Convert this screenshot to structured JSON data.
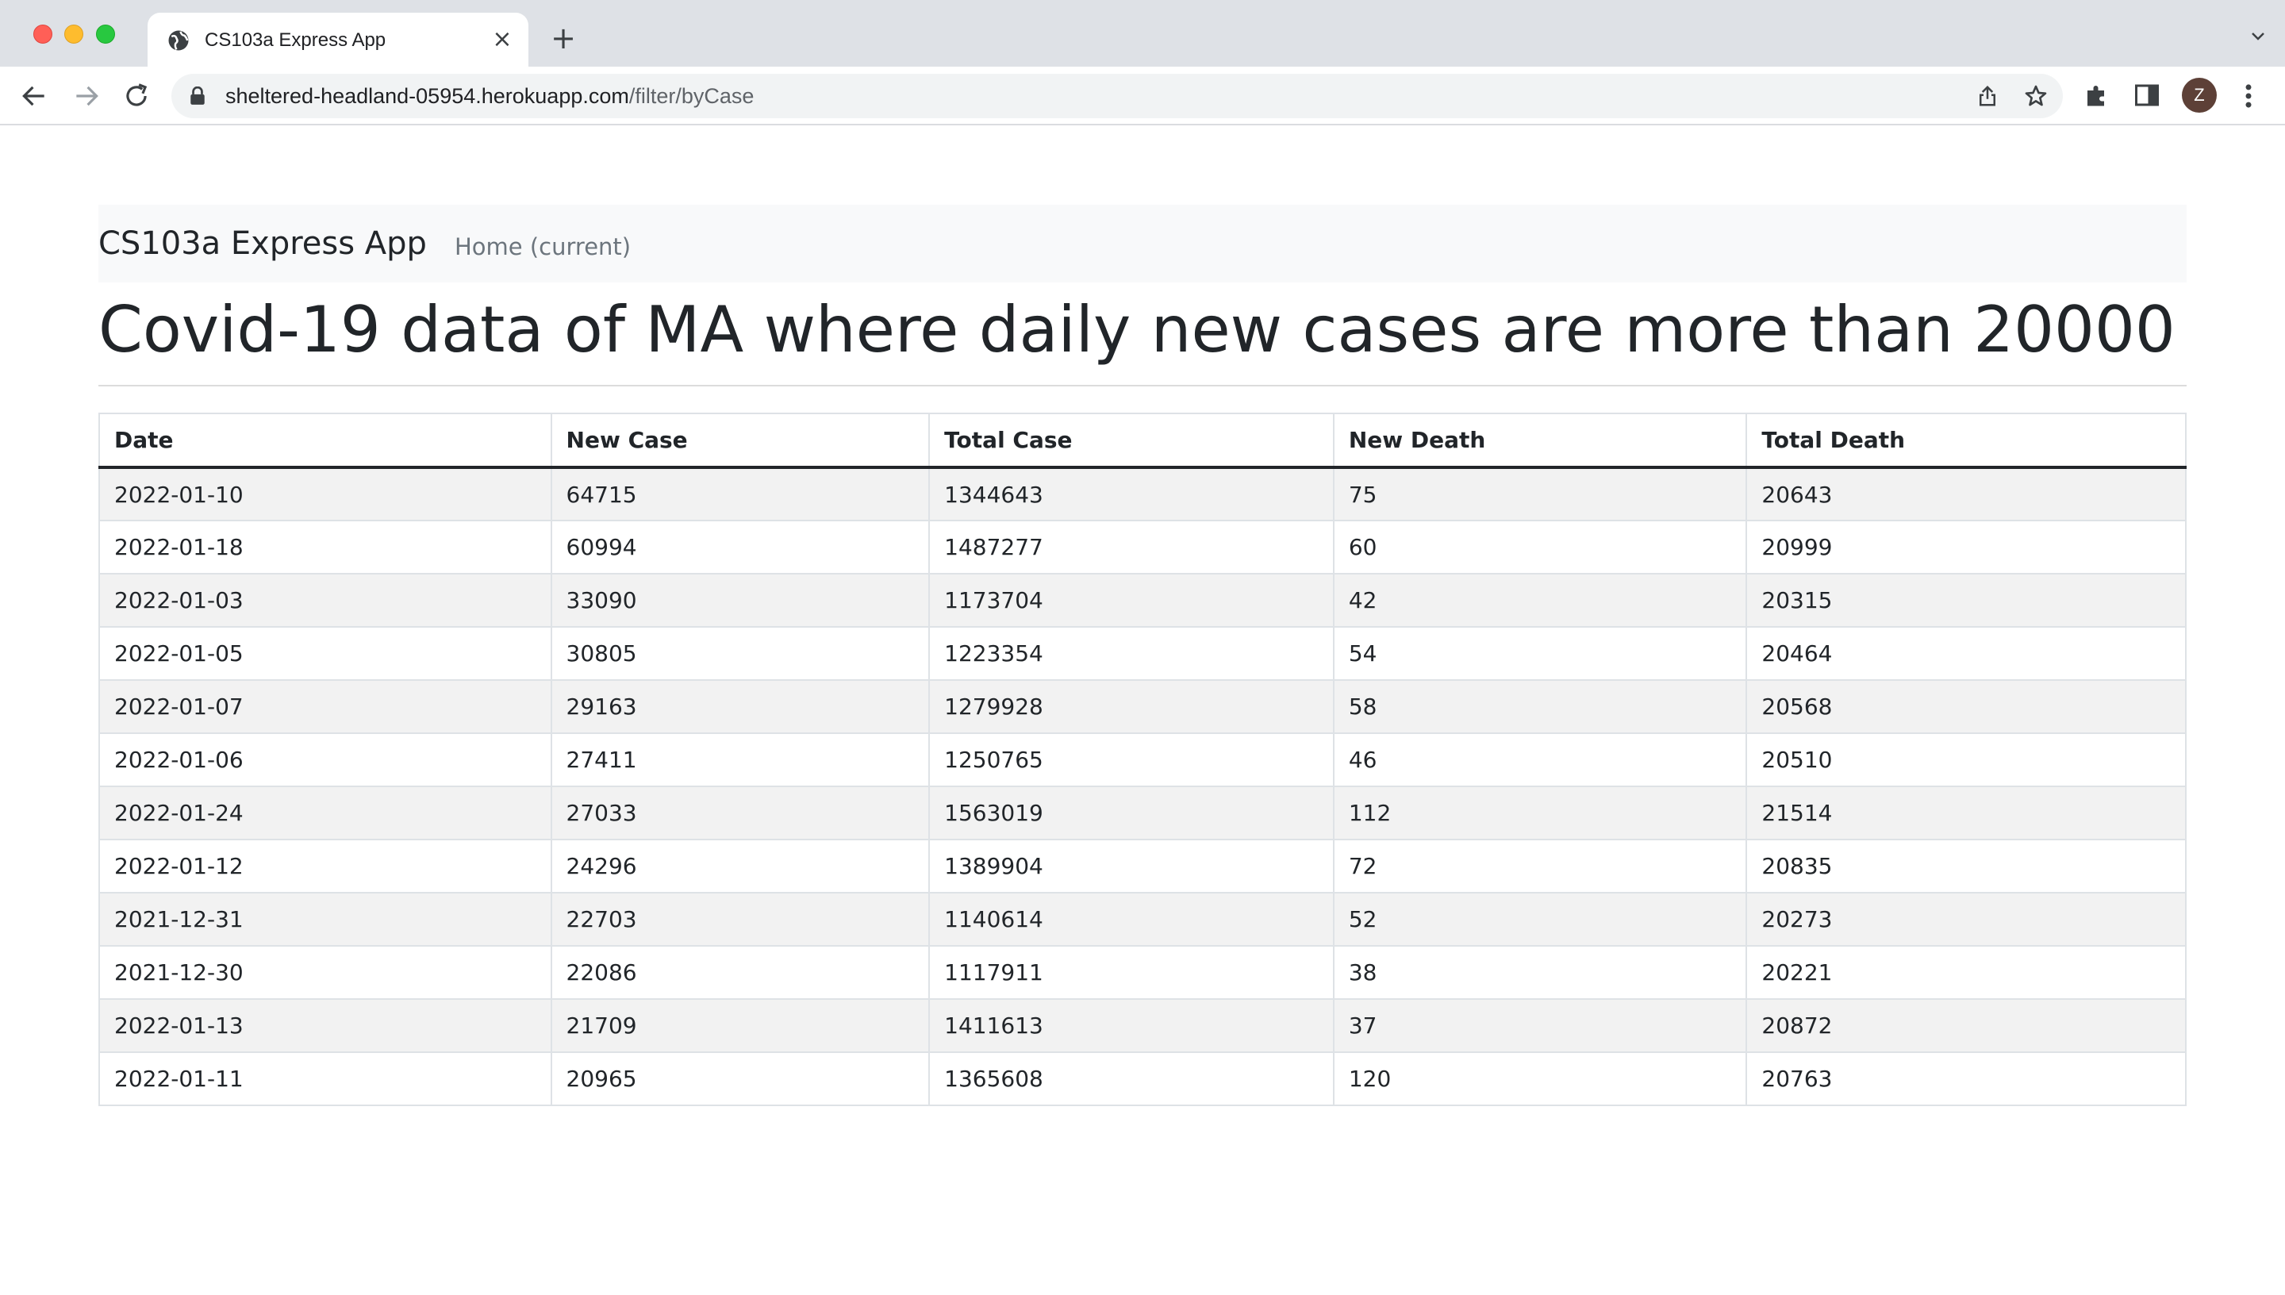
{
  "browser": {
    "tab_title": "CS103a Express App",
    "url_host": "sheltered-headland-05954.herokuapp.com",
    "url_path": "/filter/byCase",
    "profile_initial": "Z"
  },
  "navbar": {
    "brand": "CS103a Express App",
    "home_link": "Home (current)"
  },
  "heading": "Covid-19 data of MA where daily new cases are more than 20000",
  "table": {
    "headers": [
      "Date",
      "New Case",
      "Total Case",
      "New Death",
      "Total Death"
    ],
    "rows": [
      [
        "2022-01-10",
        "64715",
        "1344643",
        "75",
        "20643"
      ],
      [
        "2022-01-18",
        "60994",
        "1487277",
        "60",
        "20999"
      ],
      [
        "2022-01-03",
        "33090",
        "1173704",
        "42",
        "20315"
      ],
      [
        "2022-01-05",
        "30805",
        "1223354",
        "54",
        "20464"
      ],
      [
        "2022-01-07",
        "29163",
        "1279928",
        "58",
        "20568"
      ],
      [
        "2022-01-06",
        "27411",
        "1250765",
        "46",
        "20510"
      ],
      [
        "2022-01-24",
        "27033",
        "1563019",
        "112",
        "21514"
      ],
      [
        "2022-01-12",
        "24296",
        "1389904",
        "72",
        "20835"
      ],
      [
        "2021-12-31",
        "22703",
        "1140614",
        "52",
        "20273"
      ],
      [
        "2021-12-30",
        "22086",
        "1117911",
        "38",
        "20221"
      ],
      [
        "2022-01-13",
        "21709",
        "1411613",
        "37",
        "20872"
      ],
      [
        "2022-01-11",
        "20965",
        "1365608",
        "120",
        "20763"
      ]
    ]
  }
}
